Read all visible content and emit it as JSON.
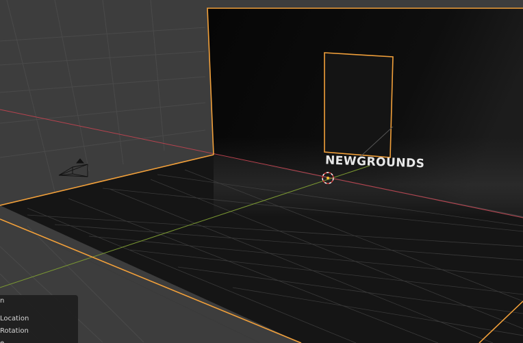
{
  "viewport": {
    "scene_text": "NEWGROUNDS",
    "colors": {
      "background": "#3d3d3d",
      "grid": "#4a4a4a",
      "floor": "#151515",
      "wall": "#0b0b0b",
      "selection": "#f2a03a",
      "x_axis": "#b8434f",
      "y_axis": "#7c9a32"
    },
    "icons": [
      "camera-icon",
      "3d-cursor-icon"
    ]
  },
  "operator_panel": {
    "rows": [
      "n",
      "Location",
      "Rotation",
      "e"
    ]
  }
}
